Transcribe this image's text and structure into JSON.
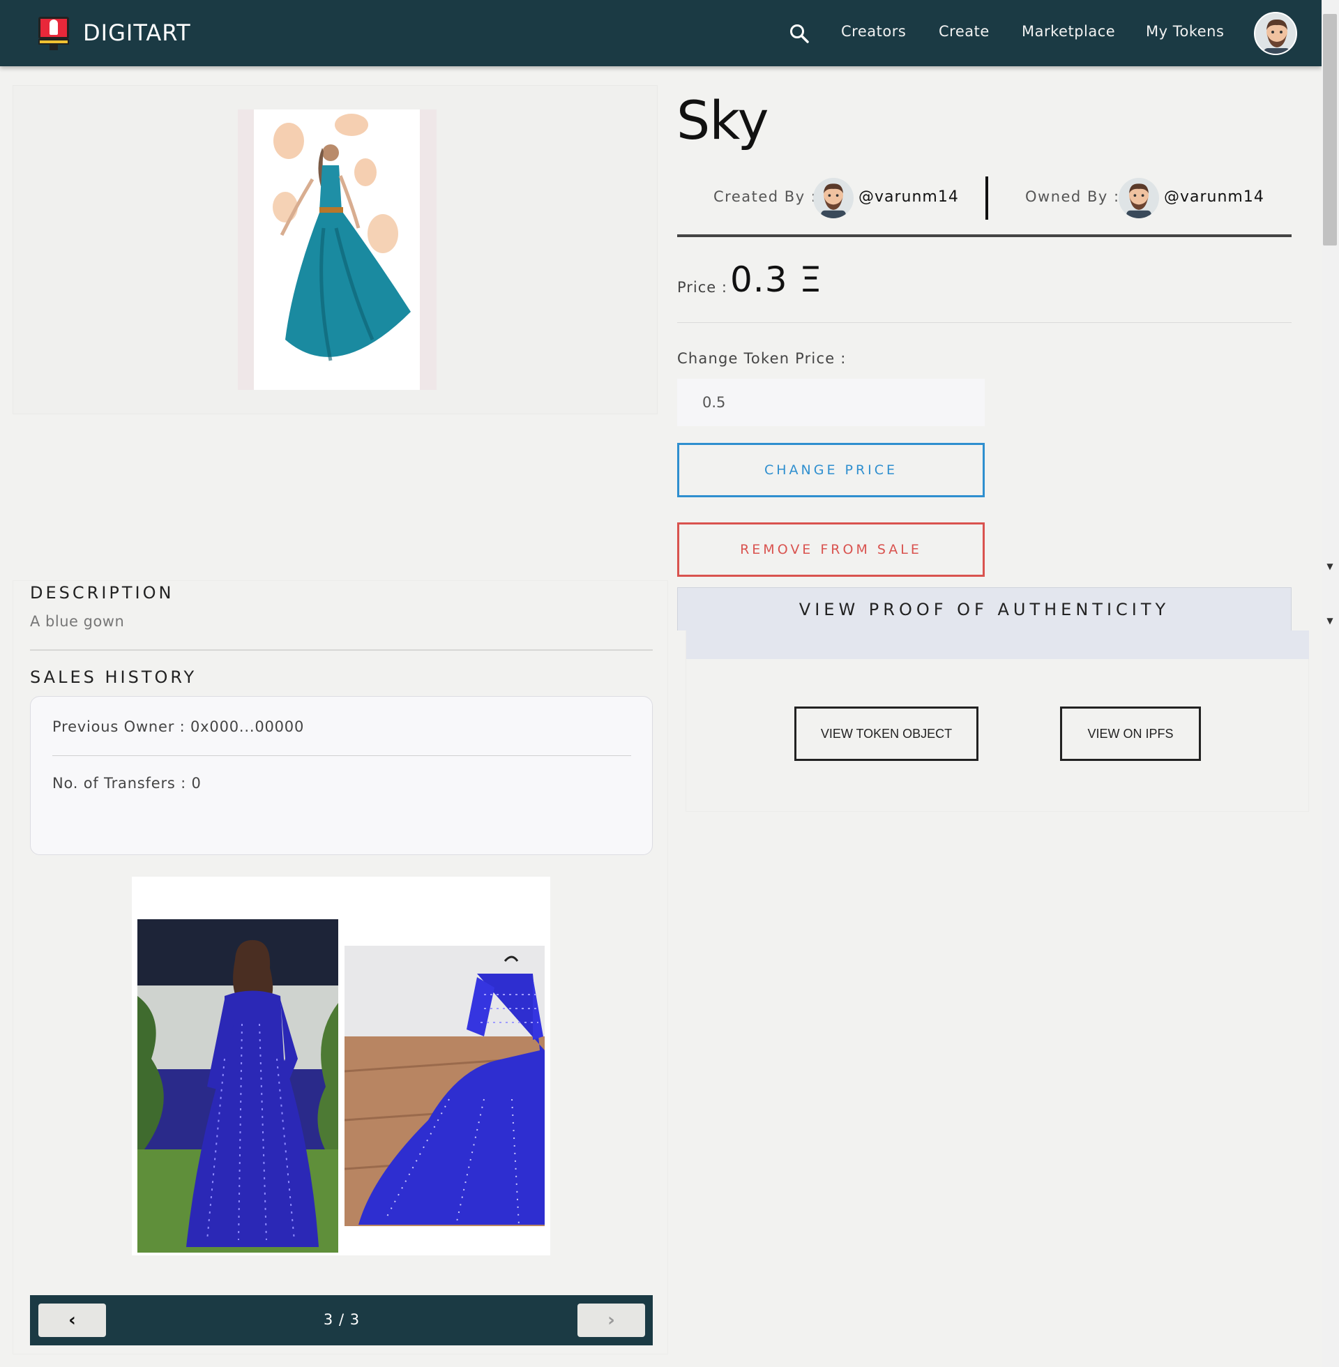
{
  "navbar": {
    "brand": "DIGITART",
    "links": [
      "Creators",
      "Create",
      "Marketplace",
      "My Tokens"
    ]
  },
  "token": {
    "title": "Sky",
    "created_by_label": "Created By :",
    "creator": "@varunm14",
    "owned_by_label": "Owned By :",
    "owner": "@varunm14",
    "price_label": "Price :",
    "price_value": "0.3 Ξ",
    "change_price_label": "Change Token Price :",
    "change_price_value": "0.5",
    "change_price_button": "CHANGE PRICE",
    "remove_button": "REMOVE FROM SALE",
    "proof_header": "VIEW PROOF OF AUTHENTICITY",
    "view_token_button": "VIEW TOKEN OBJECT",
    "view_ipfs_button": "VIEW ON IPFS"
  },
  "description": {
    "title": "DESCRIPTION",
    "text": "A blue gown"
  },
  "sales_history": {
    "title": "SALES HISTORY",
    "previous_owner": "Previous Owner : 0x000...00000",
    "transfers": "No. of Transfers : 0"
  },
  "pager": {
    "count": "3 / 3"
  },
  "colors": {
    "navbar": "#1b3a44",
    "change_price": "#2f8fcf",
    "remove": "#d9534f"
  }
}
